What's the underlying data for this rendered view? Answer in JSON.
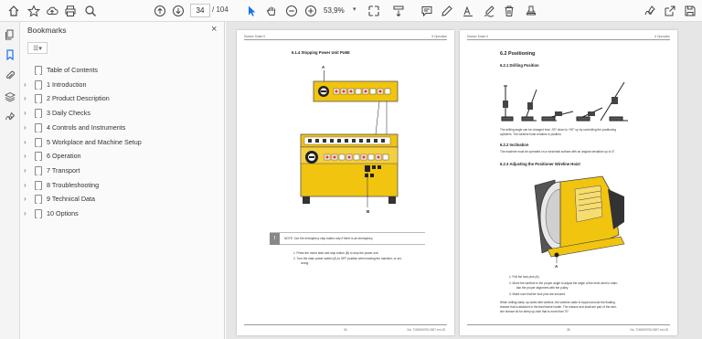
{
  "toolbar": {
    "page_current": "34",
    "page_sep": "/ 104",
    "zoom": "53,9%",
    "zoom_caret": "▾"
  },
  "panel": {
    "title": "Bookmarks",
    "close": "×",
    "options": "☰▾",
    "items": [
      {
        "label": "Table of Contents",
        "expandable": false
      },
      {
        "label": "1 Introduction",
        "expandable": true
      },
      {
        "label": "2 Product Description",
        "expandable": true
      },
      {
        "label": "3 Daily Checks",
        "expandable": true
      },
      {
        "label": "4 Controls and Instruments",
        "expandable": true
      },
      {
        "label": "5 Workplace and Machine Setup",
        "expandable": true
      },
      {
        "label": "6 Operation",
        "expandable": true
      },
      {
        "label": "7 Transport",
        "expandable": true
      },
      {
        "label": "8 Troubleshooting",
        "expandable": true
      },
      {
        "label": "9 Technical Data",
        "expandable": true
      },
      {
        "label": "10 Options",
        "expandable": true
      }
    ]
  },
  "left_page": {
    "header_left": "Diamec Smart 6",
    "header_right": "6 Operation",
    "section": "6.1.4 Stopping Power Unit PU6E",
    "label_a": "A",
    "label_b": "B",
    "note_badge": "!",
    "note_text": "NOTE: Use the emergency stop button only if there is an emergency.",
    "step1": "1.   Press the motor start and stop button (B) to stop the power unit.",
    "step2": "2.   Turn the main power switch (A) to OFF position when leaving the machine, or ser-",
    "step2b": "vicing.",
    "footer_page": "34",
    "footer_doc": "No. 7100000700.0007 en-US"
  },
  "right_page": {
    "header_left": "Diamec Smart 6",
    "header_right": "6 Operation",
    "section": "6.2  Positioning",
    "sub1": "6.2.1 Drilling Position",
    "body1a": "The drilling angle can be changed from -90° down to +90° up by controlling the positioning",
    "body1b": "cylinders. The wireline hoist remains in position.",
    "sub2": "6.2.2 Inclination",
    "body2": "The machine must be operated on a horizontal surface with an angular deviation up to 3°.",
    "sub3": "6.2.3 Adjusting the Positioner Wireline Hoist",
    "label_a": "A",
    "step1": "1.   Pull the lock pins (A).",
    "step2": "2.   Move the wireline to the proper angle to adjust the angle of the level wind to main-",
    "step2b": "tain the proper alignment with the pulley.",
    "step3": "3.   Make sure that the lock pins are secured.",
    "body4a": "When drilling steep up-holes with wireline, the wireline cable is looped around the floating",
    "body4b": "sheave that is attached in the feed frame holder. The sheave and shaft are part of the wire-",
    "body4c": "line sheave kit for steep up-hole that is more than 70°.",
    "footer_page": "35",
    "footer_doc": "No. 7100000700.0007 en-US"
  },
  "colors": {
    "accent": "#1a73e8",
    "panel_yellow": "#f1c40f"
  }
}
